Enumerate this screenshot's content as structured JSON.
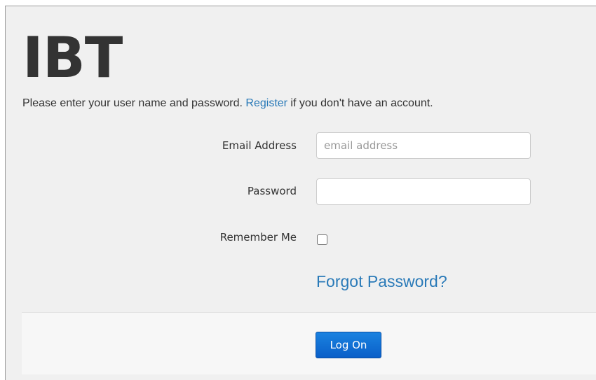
{
  "logo": {
    "text": "IBT"
  },
  "intro": {
    "prefix": "Please enter your user name and password. ",
    "register_link": "Register",
    "suffix": " if you don't have an account."
  },
  "form": {
    "email": {
      "label": "Email Address",
      "placeholder": "email address",
      "value": ""
    },
    "password": {
      "label": "Password",
      "value": ""
    },
    "remember": {
      "label": "Remember Me",
      "checked": false
    },
    "forgot_link": "Forgot Password?"
  },
  "actions": {
    "logon_label": "Log On"
  },
  "colors": {
    "link": "#2a7ab8",
    "button": "#0a5fc8",
    "background": "#f0f0f0"
  }
}
